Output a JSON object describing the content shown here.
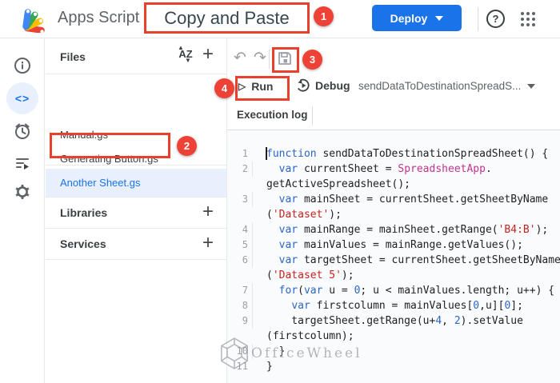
{
  "topbar": {
    "app_name": "Apps Script",
    "project_title": "Copy and Paste",
    "deploy_label": "Deploy",
    "help_glyph": "?"
  },
  "annotations": {
    "box_color": "#e8402c",
    "badge_color": "#ee4237",
    "badges": [
      "1",
      "2",
      "3",
      "4"
    ]
  },
  "rail": {
    "icons": [
      "overview-info",
      "editor-code",
      "triggers-clock",
      "executions-list",
      "settings-gear"
    ],
    "selected": "editor-code"
  },
  "files_panel": {
    "header": "Files",
    "files": [
      {
        "name": "Manual.gs",
        "selected": false
      },
      {
        "name": "Generating Button.gs",
        "selected": false
      },
      {
        "name": "Another Sheet.gs",
        "selected": true
      }
    ],
    "sections": [
      {
        "label": "Libraries"
      },
      {
        "label": "Services"
      }
    ],
    "selected_color": "#1a73e8",
    "selected_bg": "#e8f0fe"
  },
  "toolbar": {
    "run_label": "Run",
    "debug_label": "Debug",
    "function_selector": "sendDataToDestinationSpreadS...",
    "execution_log": "Execution log"
  },
  "editor": {
    "colors": {
      "kw": "#2a66c9",
      "cls": "#c2348f",
      "str": "#c5221f",
      "num": "#2a66c9",
      "pl": "#202124"
    },
    "rows": [
      {
        "num": "1",
        "guide": false,
        "tokens": [
          {
            "c": "kw",
            "t": "function"
          },
          {
            "c": "pl",
            "t": " sendDataToDestinationSpreadSheet() {"
          }
        ]
      },
      {
        "num": "2",
        "guide": true,
        "tokens": [
          {
            "c": "pl",
            "t": "  "
          },
          {
            "c": "kw",
            "t": "var"
          },
          {
            "c": "pl",
            "t": " currentSheet = "
          },
          {
            "c": "cls",
            "t": "SpreadsheetApp"
          },
          {
            "c": "pl",
            "t": "."
          }
        ]
      },
      {
        "num": "",
        "guide": false,
        "tokens": [
          {
            "c": "pl",
            "t": "getActiveSpreadsheet();"
          }
        ]
      },
      {
        "num": "3",
        "guide": true,
        "tokens": [
          {
            "c": "pl",
            "t": "  "
          },
          {
            "c": "kw",
            "t": "var"
          },
          {
            "c": "pl",
            "t": " mainSheet = currentSheet.getSheetByName"
          }
        ]
      },
      {
        "num": "",
        "guide": false,
        "tokens": [
          {
            "c": "pl",
            "t": "("
          },
          {
            "c": "str",
            "t": "'Dataset'"
          },
          {
            "c": "pl",
            "t": ");"
          }
        ]
      },
      {
        "num": "4",
        "guide": true,
        "tokens": [
          {
            "c": "pl",
            "t": "  "
          },
          {
            "c": "kw",
            "t": "var"
          },
          {
            "c": "pl",
            "t": " mainRange = mainSheet.getRange("
          },
          {
            "c": "str",
            "t": "'B4:B'"
          },
          {
            "c": "pl",
            "t": ");"
          }
        ]
      },
      {
        "num": "5",
        "guide": true,
        "tokens": [
          {
            "c": "pl",
            "t": "  "
          },
          {
            "c": "kw",
            "t": "var"
          },
          {
            "c": "pl",
            "t": " mainValues = mainRange.getValues();"
          }
        ]
      },
      {
        "num": "6",
        "guide": true,
        "tokens": [
          {
            "c": "pl",
            "t": "  "
          },
          {
            "c": "kw",
            "t": "var"
          },
          {
            "c": "pl",
            "t": " targetSheet = currentSheet.getSheetByName"
          }
        ]
      },
      {
        "num": "",
        "guide": false,
        "tokens": [
          {
            "c": "pl",
            "t": "("
          },
          {
            "c": "str",
            "t": "'Dataset 5'"
          },
          {
            "c": "pl",
            "t": ");"
          }
        ]
      },
      {
        "num": "7",
        "guide": true,
        "tokens": [
          {
            "c": "pl",
            "t": "  "
          },
          {
            "c": "kw",
            "t": "for"
          },
          {
            "c": "pl",
            "t": "("
          },
          {
            "c": "kw",
            "t": "var"
          },
          {
            "c": "pl",
            "t": " u = "
          },
          {
            "c": "num",
            "t": "0"
          },
          {
            "c": "pl",
            "t": "; u < mainValues.length; u++) {"
          }
        ]
      },
      {
        "num": "8",
        "guide": true,
        "tokens": [
          {
            "c": "pl",
            "t": "    "
          },
          {
            "c": "kw",
            "t": "var"
          },
          {
            "c": "pl",
            "t": " firstcolumn = mainValues["
          },
          {
            "c": "num",
            "t": "0"
          },
          {
            "c": "pl",
            "t": ",u]["
          },
          {
            "c": "num",
            "t": "0"
          },
          {
            "c": "pl",
            "t": "];"
          }
        ]
      },
      {
        "num": "9",
        "guide": true,
        "tokens": [
          {
            "c": "pl",
            "t": "    targetSheet.getRange(u+"
          },
          {
            "c": "num",
            "t": "4"
          },
          {
            "c": "pl",
            "t": ", "
          },
          {
            "c": "num",
            "t": "2"
          },
          {
            "c": "pl",
            "t": ").setValue"
          }
        ]
      },
      {
        "num": "",
        "guide": false,
        "tokens": [
          {
            "c": "pl",
            "t": "(firstcolumn);"
          }
        ]
      },
      {
        "num": "10",
        "guide": true,
        "tokens": [
          {
            "c": "pl",
            "t": "  }"
          }
        ]
      },
      {
        "num": "11",
        "guide": false,
        "tokens": [
          {
            "c": "pl",
            "t": "}"
          }
        ]
      }
    ]
  },
  "watermark": {
    "text": "OfficeWheel"
  }
}
